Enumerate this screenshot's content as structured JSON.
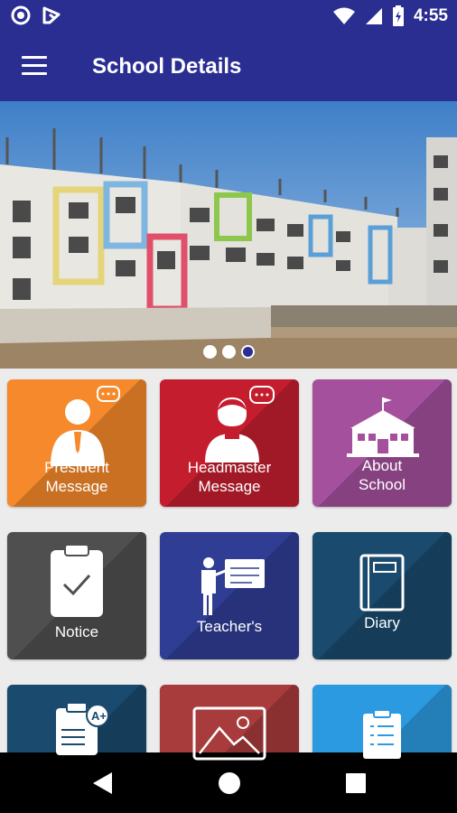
{
  "status_bar": {
    "time": "4:55"
  },
  "app_bar": {
    "title": "School Details"
  },
  "banner": {
    "slide_count": 3,
    "active_slide": 3
  },
  "tiles": [
    {
      "label_line1": "President",
      "label_line2": "Message",
      "color": "#f5892b",
      "icon": "president-avatar-icon"
    },
    {
      "label_line1": "Headmaster",
      "label_line2": "Message",
      "color": "#c41e2e",
      "icon": "headmaster-avatar-icon"
    },
    {
      "label_line1": "About",
      "label_line2": "School",
      "color": "#a4509c",
      "icon": "school-building-icon"
    },
    {
      "label": "Notice",
      "color": "#4f4f4f",
      "icon": "clipboard-check-icon"
    },
    {
      "label": "Teacher's",
      "color": "#2f3d95",
      "icon": "teacher-board-icon"
    },
    {
      "label": "Diary",
      "color": "#1a4a6e",
      "icon": "notebook-icon"
    },
    {
      "label": "",
      "color": "#1a4a6e",
      "icon": "report-card-icon"
    },
    {
      "label": "",
      "color": "#a83b3b",
      "icon": "gallery-image-icon"
    },
    {
      "label": "",
      "color": "#2c9ae0",
      "icon": "checklist-icon"
    }
  ]
}
